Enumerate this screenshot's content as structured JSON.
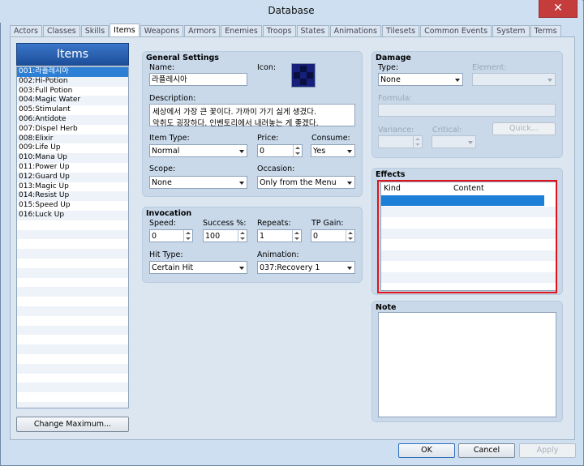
{
  "window": {
    "title": "Database",
    "close_glyph": "✕"
  },
  "tabs": [
    "Actors",
    "Classes",
    "Skills",
    "Items",
    "Weapons",
    "Armors",
    "Enemies",
    "Troops",
    "States",
    "Animations",
    "Tilesets",
    "Common Events",
    "System",
    "Terms"
  ],
  "active_tab": "Items",
  "items_list": {
    "header": "Items",
    "items": [
      "001:라플레시아",
      "002:Hi-Potion",
      "003:Full Potion",
      "004:Magic Water",
      "005:Stimulant",
      "006:Antidote",
      "007:Dispel Herb",
      "008:Elixir",
      "009:Life Up",
      "010:Mana Up",
      "011:Power Up",
      "012:Guard Up",
      "013:Magic Up",
      "014:Resist Up",
      "015:Speed Up",
      "016:Luck Up"
    ],
    "change_max_label": "Change Maximum..."
  },
  "general": {
    "title": "General Settings",
    "name_label": "Name:",
    "name_value": "라플레시아",
    "icon_label": "Icon:",
    "description_label": "Description:",
    "description_line1": "세상에서 가장 큰 꽃이다. 가까이 가기 싫게 생겼다.",
    "description_line2": "악취도 굉장하다. 인벤토리에서 내려놓는 게 좋겠다.",
    "item_type_label": "Item Type:",
    "item_type_value": "Normal",
    "price_label": "Price:",
    "price_value": "0",
    "consume_label": "Consume:",
    "consume_value": "Yes",
    "scope_label": "Scope:",
    "scope_value": "None",
    "occasion_label": "Occasion:",
    "occasion_value": "Only from the Menu"
  },
  "invocation": {
    "title": "Invocation",
    "speed_label": "Speed:",
    "speed_value": "0",
    "success_label": "Success %:",
    "success_value": "100",
    "repeats_label": "Repeats:",
    "repeats_value": "1",
    "tp_gain_label": "TP Gain:",
    "tp_gain_value": "0",
    "hit_type_label": "Hit Type:",
    "hit_type_value": "Certain Hit",
    "animation_label": "Animation:",
    "animation_value": "037:Recovery 1"
  },
  "damage": {
    "title": "Damage",
    "type_label": "Type:",
    "type_value": "None",
    "element_label": "Element:",
    "formula_label": "Formula:",
    "variance_label": "Variance:",
    "critical_label": "Critical:",
    "quick_label": "Quick..."
  },
  "effects": {
    "title": "Effects",
    "col_kind": "Kind",
    "col_content": "Content",
    "highlight_color": "#e0131b"
  },
  "note": {
    "title": "Note"
  },
  "footer": {
    "ok_label": "OK",
    "cancel_label": "Cancel",
    "apply_label": "Apply"
  },
  "colors": {
    "accent": "#2d7fd6",
    "panel": "#c9d9ea",
    "background": "#cfe0f0"
  }
}
